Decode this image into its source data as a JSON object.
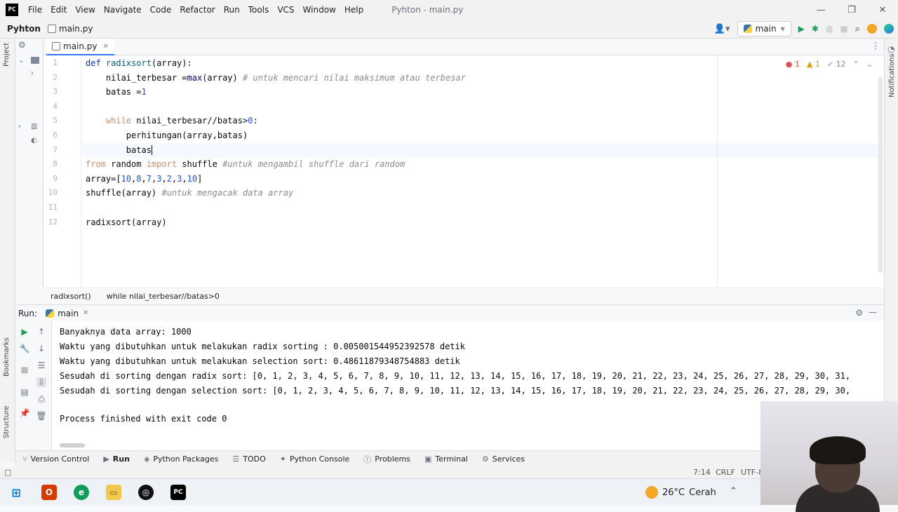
{
  "window": {
    "logo": "PC",
    "title": "Pyhton - main.py",
    "menu": [
      "File",
      "Edit",
      "View",
      "Navigate",
      "Code",
      "Refactor",
      "Run",
      "Tools",
      "VCS",
      "Window",
      "Help"
    ],
    "controls": [
      "—",
      "❐",
      "✕"
    ]
  },
  "navbar": {
    "project": "Pyhton",
    "file": "main.py",
    "run_config": "main"
  },
  "left_tool": {
    "project_label": "Project",
    "bookmarks_label": "Bookmarks",
    "structure_label": "Structure"
  },
  "right_tool": {
    "notifications_label": "Notifications"
  },
  "editor": {
    "tab": "main.py",
    "inspections": {
      "errors": "1",
      "warnings": "1",
      "weak": "12"
    },
    "lines": [
      {
        "n": "1",
        "parts": [
          [
            "kw",
            "def "
          ],
          [
            "fn",
            "radixsort"
          ],
          [
            "",
            "(array):"
          ]
        ]
      },
      {
        "n": "2",
        "parts": [
          [
            "",
            "    nilai_terbesar ="
          ],
          [
            "bi",
            "max"
          ],
          [
            "",
            "(array) "
          ],
          [
            "cmt",
            "# untuk mencari nilai maksimum atau terbesar"
          ]
        ]
      },
      {
        "n": "3",
        "parts": [
          [
            "",
            "    batas ="
          ],
          [
            "num",
            "1"
          ]
        ]
      },
      {
        "n": "4",
        "parts": [
          [
            "",
            ""
          ]
        ]
      },
      {
        "n": "5",
        "parts": [
          [
            "kw2",
            "    while "
          ],
          [
            "",
            "nilai_terbesar//batas>"
          ],
          [
            "num",
            "0"
          ],
          [
            "",
            ":"
          ]
        ]
      },
      {
        "n": "6",
        "parts": [
          [
            "",
            "        perhitungan(array,batas)"
          ]
        ]
      },
      {
        "n": "7",
        "parts": [
          [
            "",
            "        batas"
          ]
        ]
      },
      {
        "n": "8",
        "parts": [
          [
            "kw2",
            "from "
          ],
          [
            "",
            "random "
          ],
          [
            "kw2",
            "import "
          ],
          [
            "",
            "shuffle "
          ],
          [
            "cmt",
            "#untuk mengambil shuffle dari random"
          ]
        ]
      },
      {
        "n": "9",
        "parts": [
          [
            "",
            "array=["
          ],
          [
            "num",
            "10"
          ],
          [
            "",
            ","
          ],
          [
            "num",
            "8"
          ],
          [
            "",
            ","
          ],
          [
            "num",
            "7"
          ],
          [
            "",
            ","
          ],
          [
            "num",
            "3"
          ],
          [
            "",
            ","
          ],
          [
            "num",
            "2"
          ],
          [
            "",
            ","
          ],
          [
            "num",
            "3"
          ],
          [
            "",
            ","
          ],
          [
            "num",
            "10"
          ],
          [
            "",
            "]"
          ]
        ]
      },
      {
        "n": "10",
        "parts": [
          [
            "",
            "shuffle(array) "
          ],
          [
            "cmt",
            "#untuk mengacak data array"
          ]
        ]
      },
      {
        "n": "11",
        "parts": [
          [
            "",
            ""
          ]
        ]
      },
      {
        "n": "12",
        "parts": [
          [
            "",
            "radixsort(array)"
          ]
        ]
      }
    ],
    "breadcrumb": [
      "radixsort()",
      "while nilai_terbesar//batas>0"
    ]
  },
  "run": {
    "label": "Run:",
    "tab": "main",
    "output": [
      "Banyaknya data array: 1000",
      "Waktu yang dibutuhkan untuk melakukan radix sorting : 0.005001544952392578 detik",
      "Waktu yang dibutuhkan untuk melakukan selection sort: 0.48611879348754883 detik",
      "Sesudah di sorting dengan radix sort: [0, 1, 2, 3, 4, 5, 6, 7, 8, 9, 10, 11, 12, 13, 14, 15, 16, 17, 18, 19, 20, 21, 22, 23, 24, 25, 26, 27, 28, 29, 30, 31,",
      "Sesudah di sorting dengan selection sort: [0, 1, 2, 3, 4, 5, 6, 7, 8, 9, 10, 11, 12, 13, 14, 15, 16, 17, 18, 19, 20, 21, 22, 23, 24, 25, 26, 27, 28, 29, 30,",
      "",
      "Process finished with exit code 0"
    ]
  },
  "bottom_tabs": [
    "Version Control",
    "Run",
    "Python Packages",
    "TODO",
    "Python Console",
    "Problems",
    "Terminal",
    "Services"
  ],
  "status": {
    "position": "7:14",
    "line_sep": "CRLF",
    "encoding": "UTF-8"
  },
  "taskbar": {
    "temp": "26°C",
    "weather": "Cerah"
  }
}
